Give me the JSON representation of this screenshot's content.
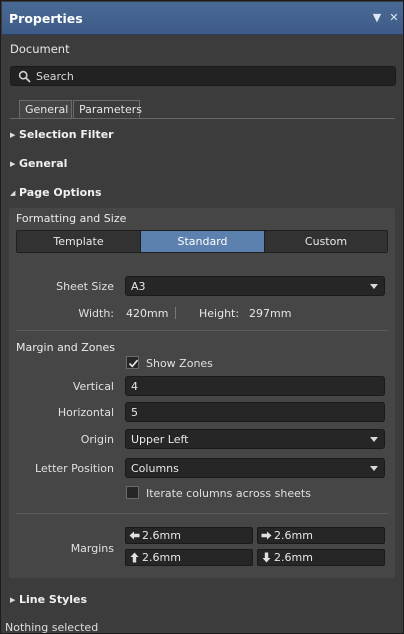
{
  "panel": {
    "title": "Properties",
    "pin_glyph": "▼",
    "close_glyph": "✕"
  },
  "document_label": "Document",
  "search": {
    "placeholder": "Search",
    "icon": "search-icon"
  },
  "tabs": [
    {
      "label": "General",
      "active": true
    },
    {
      "label": "Parameters",
      "active": false
    }
  ],
  "sections": {
    "selection_filter": {
      "label": "Selection Filter",
      "expanded": false
    },
    "general": {
      "label": "General",
      "expanded": false
    },
    "page_options": {
      "label": "Page Options",
      "expanded": true
    },
    "line_styles": {
      "label": "Line Styles",
      "expanded": false
    }
  },
  "formatting": {
    "header": "Formatting and Size",
    "modes": [
      "Template",
      "Standard",
      "Custom"
    ],
    "active_mode": "Standard",
    "sheet_size_label": "Sheet Size",
    "sheet_size_value": "A3",
    "width_label": "Width:",
    "width_value": "420mm",
    "height_label": "Height:",
    "height_value": "297mm"
  },
  "margin_zones": {
    "header": "Margin and Zones",
    "show_zones_label": "Show Zones",
    "show_zones_checked": true,
    "vertical_label": "Vertical",
    "vertical_value": "4",
    "horizontal_label": "Horizontal",
    "horizontal_value": "5",
    "origin_label": "Origin",
    "origin_value": "Upper Left",
    "letter_position_label": "Letter Position",
    "letter_position_value": "Columns",
    "iterate_label": "Iterate columns across sheets",
    "iterate_checked": false,
    "margins_label": "Margins",
    "margin_left": "2.6mm",
    "margin_right": "2.6mm",
    "margin_top": "2.6mm",
    "margin_bottom": "2.6mm"
  },
  "status": "Nothing selected",
  "colors": {
    "titlebar": "#4a6a96",
    "accent_active": "#5d81ae",
    "panel_bg": "#3c3c3c",
    "inner_bg": "#464646"
  }
}
